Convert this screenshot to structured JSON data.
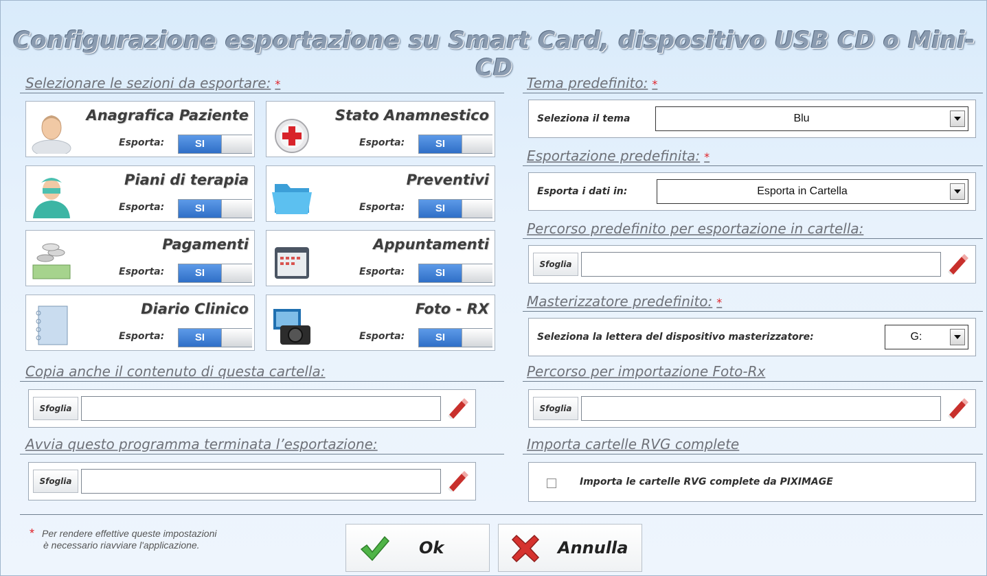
{
  "title": "Configurazione esportazione su Smart Card, dispositivo USB  CD o Mini-CD",
  "required_mark": "*",
  "sections": {
    "select_sections": "Selezionare le sezioni da esportare:",
    "copy_folder": "Copia anche il contenuto di questa cartella:",
    "launch_program": "Avvia questo programma terminata l’esportazione:",
    "default_theme": "Tema predefinito:",
    "default_export": "Esportazione predefinita:",
    "default_path": "Percorso predefinito per esportazione in cartella:",
    "default_burner": "Masterizzatore predefinito:",
    "import_path": "Percorso per importazione Foto-Rx",
    "import_rvg": "Importa cartelle RVG complete"
  },
  "cards": [
    {
      "title": "Anagrafica Paziente",
      "icon": "patient-icon",
      "export_label": "Esporta:",
      "toggle": "SI"
    },
    {
      "title": "Stato Anamnestico",
      "icon": "medical-cross-icon",
      "export_label": "Esporta:",
      "toggle": "SI"
    },
    {
      "title": "Piani di terapia",
      "icon": "dentist-icon",
      "export_label": "Esporta:",
      "toggle": "SI"
    },
    {
      "title": "Preventivi",
      "icon": "folder-icon",
      "export_label": "Esporta:",
      "toggle": "SI"
    },
    {
      "title": "Pagamenti",
      "icon": "money-icon",
      "export_label": "Esporta:",
      "toggle": "SI"
    },
    {
      "title": "Appuntamenti",
      "icon": "calendar-icon",
      "export_label": "Esporta:",
      "toggle": "SI"
    },
    {
      "title": "Diario Clinico",
      "icon": "diary-icon",
      "export_label": "Esporta:",
      "toggle": "SI"
    },
    {
      "title": "Foto - RX",
      "icon": "camera-icon",
      "export_label": "Esporta:",
      "toggle": "SI"
    }
  ],
  "theme": {
    "label": "Seleziona il tema",
    "value": "Blu"
  },
  "export": {
    "label": "Esporta i dati in:",
    "value": "Esporta in Cartella"
  },
  "burner": {
    "label": "Seleziona la lettera del dispositivo masterizzatore:",
    "value": "G:"
  },
  "browse_label": "Sfoglia",
  "paths": {
    "copy_folder": "",
    "launch_program": "",
    "default_path": "",
    "import_path": ""
  },
  "import_rvg": {
    "label": "Importa le cartelle RVG complete da PIXIMAGE",
    "checked": false
  },
  "note": {
    "line1": "Per rendere effettive queste impostazioni",
    "line2": "è necessario riavviare l'applicazione."
  },
  "buttons": {
    "ok": "Ok",
    "cancel": "Annulla"
  },
  "colors": {
    "accent_blue": "#2f6fc7",
    "required_red": "#e0242a",
    "background": "#e3effb"
  }
}
